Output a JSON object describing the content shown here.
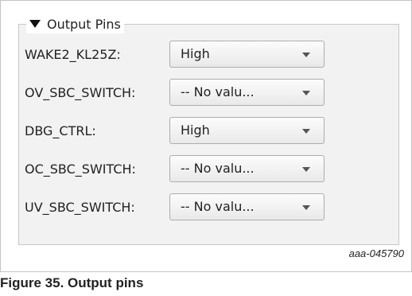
{
  "group": {
    "title": "Output Pins",
    "collapse_icon": "triangle-down-icon"
  },
  "pins": [
    {
      "label": "WAKE2_KL25Z:",
      "value": "High"
    },
    {
      "label": "OV_SBC_SWITCH:",
      "value": "-- No valu..."
    },
    {
      "label": "DBG_CTRL:",
      "value": "High"
    },
    {
      "label": "OC_SBC_SWITCH:",
      "value": "-- No valu..."
    },
    {
      "label": "UV_SBC_SWITCH:",
      "value": "-- No valu..."
    }
  ],
  "dropdown_icon": "chevron-down-icon",
  "figure": {
    "id": "aaa-045790",
    "caption": "Figure 35.  Output pins"
  }
}
